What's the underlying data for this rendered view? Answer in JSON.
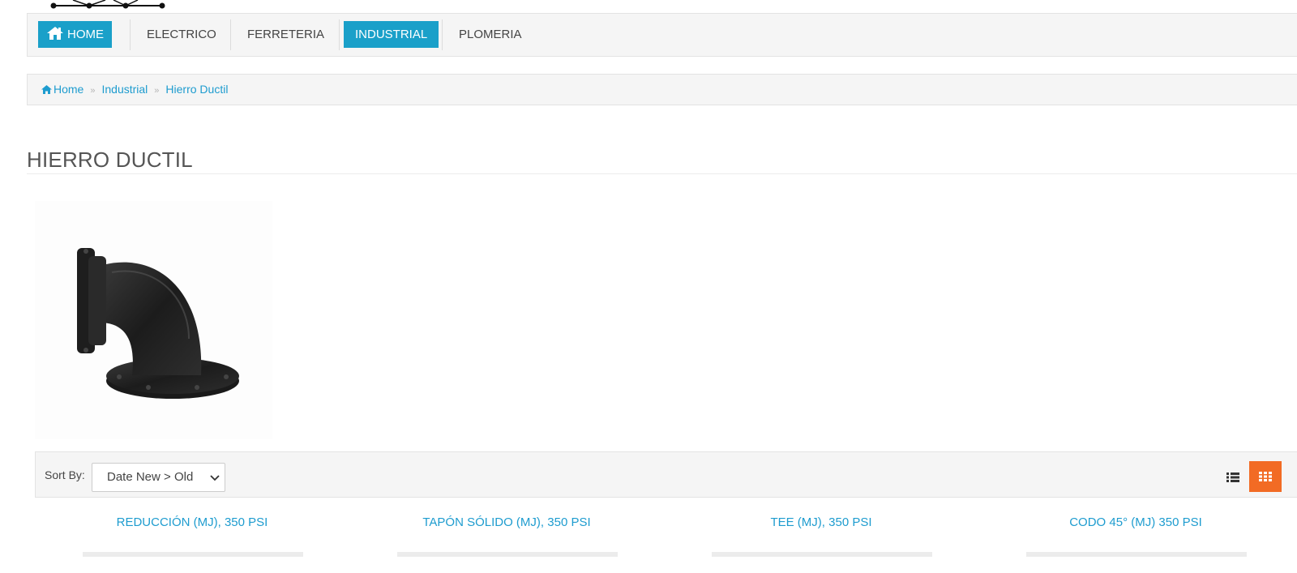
{
  "nav": {
    "items": [
      {
        "label": "HOME",
        "icon": "home-icon",
        "active": true
      },
      {
        "label": "ELECTRICO",
        "active": false
      },
      {
        "label": "FERRETERIA",
        "active": false
      },
      {
        "label": "INDUSTRIAL",
        "active": true
      },
      {
        "label": "PLOMERIA",
        "active": false
      }
    ]
  },
  "breadcrumb": {
    "icon": "home-icon",
    "items": [
      "Home",
      "Industrial",
      "Hierro Ductil"
    ],
    "separator": "»"
  },
  "category": {
    "title": "HIERRO DUCTIL",
    "image": "ductile-iron-flanged-elbow"
  },
  "toolbar": {
    "sort_label": "Sort By:",
    "sort_value": "Date New > Old",
    "list_view_icon": "list-view-icon",
    "grid_view_icon": "grid-view-icon"
  },
  "products": [
    {
      "name": "REDUCCIÓN (MJ), 350 PSI"
    },
    {
      "name": "TAPÓN SÓLIDO (MJ), 350 PSI"
    },
    {
      "name": "TEE (MJ), 350 PSI"
    },
    {
      "name": "CODO 45° (MJ) 350 PSI"
    }
  ],
  "colors": {
    "accent": "#1aa0c9",
    "link": "#1e9ccf",
    "active_view": "#f26b24",
    "panel": "#f5f5f5"
  }
}
